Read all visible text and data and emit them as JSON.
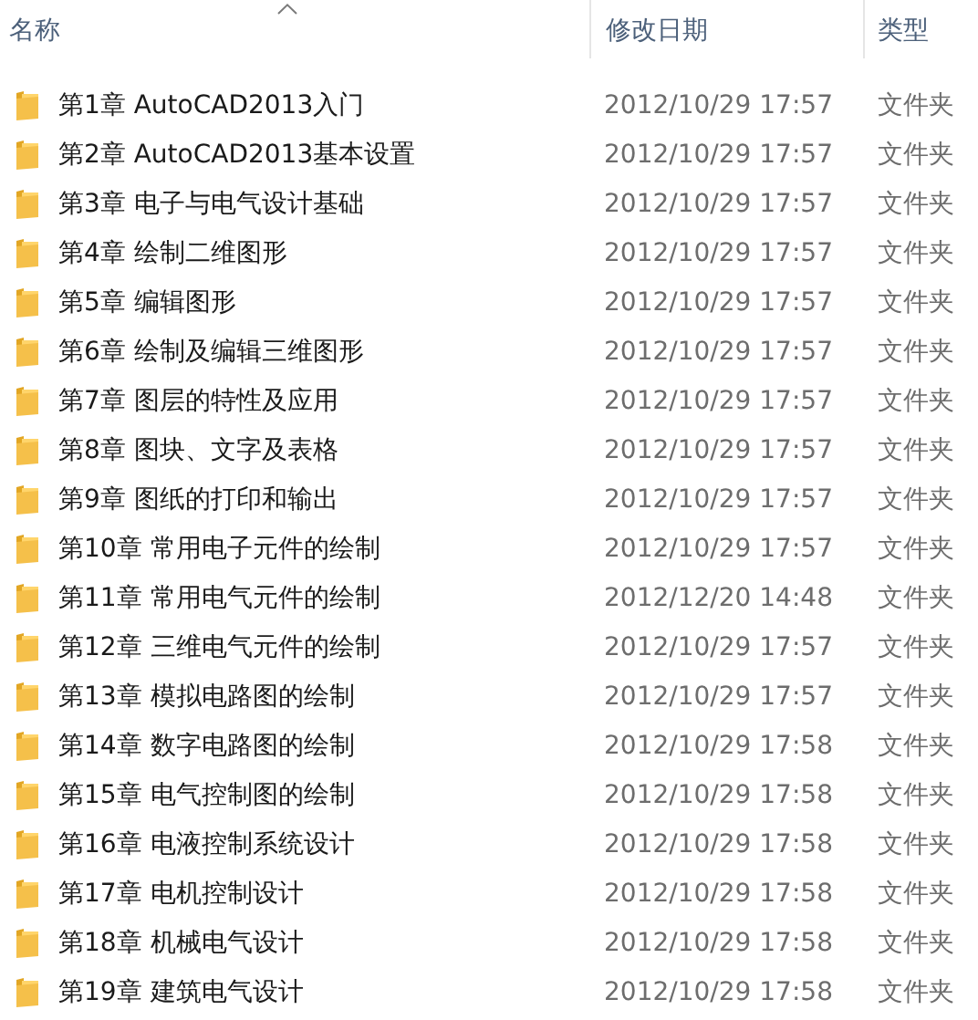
{
  "columns": [
    {
      "label": "名称",
      "sorted": true
    },
    {
      "label": "修改日期",
      "sorted": false
    },
    {
      "label": "类型",
      "sorted": false
    }
  ],
  "rows": [
    {
      "name": "第1章 AutoCAD2013入门",
      "modified": "2012/10/29 17:57",
      "type": "文件夹"
    },
    {
      "name": "第2章 AutoCAD2013基本设置",
      "modified": "2012/10/29 17:57",
      "type": "文件夹"
    },
    {
      "name": "第3章 电子与电气设计基础",
      "modified": "2012/10/29 17:57",
      "type": "文件夹"
    },
    {
      "name": "第4章 绘制二维图形",
      "modified": "2012/10/29 17:57",
      "type": "文件夹"
    },
    {
      "name": "第5章 编辑图形",
      "modified": "2012/10/29 17:57",
      "type": "文件夹"
    },
    {
      "name": "第6章 绘制及编辑三维图形",
      "modified": "2012/10/29 17:57",
      "type": "文件夹"
    },
    {
      "name": "第7章 图层的特性及应用",
      "modified": "2012/10/29 17:57",
      "type": "文件夹"
    },
    {
      "name": "第8章 图块、文字及表格",
      "modified": "2012/10/29 17:57",
      "type": "文件夹"
    },
    {
      "name": "第9章 图纸的打印和输出",
      "modified": "2012/10/29 17:57",
      "type": "文件夹"
    },
    {
      "name": "第10章 常用电子元件的绘制",
      "modified": "2012/10/29 17:57",
      "type": "文件夹"
    },
    {
      "name": "第11章 常用电气元件的绘制",
      "modified": "2012/12/20 14:48",
      "type": "文件夹"
    },
    {
      "name": "第12章 三维电气元件的绘制",
      "modified": "2012/10/29 17:57",
      "type": "文件夹"
    },
    {
      "name": "第13章 模拟电路图的绘制",
      "modified": "2012/10/29 17:57",
      "type": "文件夹"
    },
    {
      "name": "第14章 数字电路图的绘制",
      "modified": "2012/10/29 17:58",
      "type": "文件夹"
    },
    {
      "name": "第15章 电气控制图的绘制",
      "modified": "2012/10/29 17:58",
      "type": "文件夹"
    },
    {
      "name": "第16章 电液控制系统设计",
      "modified": "2012/10/29 17:58",
      "type": "文件夹"
    },
    {
      "name": "第17章 电机控制设计",
      "modified": "2012/10/29 17:58",
      "type": "文件夹"
    },
    {
      "name": "第18章 机械电气设计",
      "modified": "2012/10/29 17:58",
      "type": "文件夹"
    },
    {
      "name": "第19章 建筑电气设计",
      "modified": "2012/10/29 17:58",
      "type": "文件夹"
    }
  ]
}
